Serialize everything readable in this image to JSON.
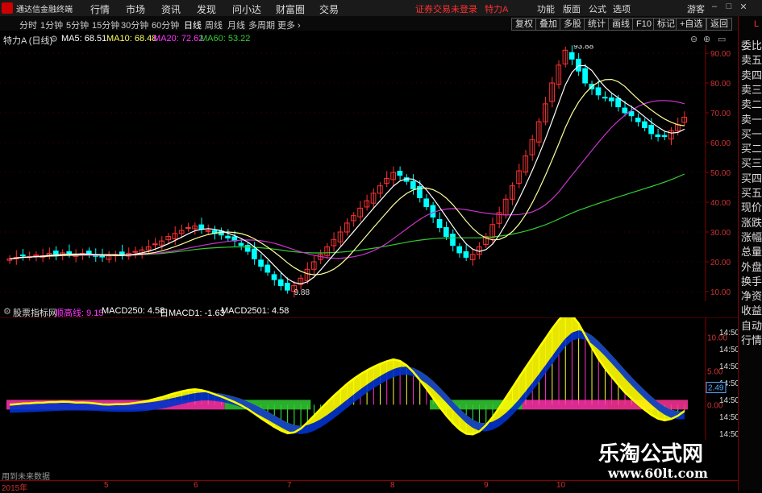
{
  "app": {
    "name": "通达信金融终端"
  },
  "menu": [
    "行情",
    "市场",
    "资讯",
    "发现",
    "问小达",
    "财富圈",
    "交易"
  ],
  "trade_status": "证券交易未登录",
  "stock_header": "特力A",
  "right_menu": [
    "功能",
    "版面",
    "公式",
    "选项",
    "游客"
  ],
  "period_tabs": [
    "分时",
    "1分钟",
    "5分钟",
    "15分钟",
    "30分钟",
    "60分钟",
    "日线",
    "周线",
    "月线",
    "多周期",
    "更多"
  ],
  "active_tab": "日线",
  "tools": [
    "复权",
    "叠加",
    "多股",
    "统计",
    "画线",
    "F10",
    "标记",
    "+自选",
    "返回"
  ],
  "right_panel": [
    "委比",
    "卖五",
    "卖四",
    "卖三",
    "卖二",
    "卖一",
    "买一",
    "买二",
    "买三",
    "买四",
    "买五",
    "现价",
    "涨跌",
    "涨幅",
    "总量",
    "外盘",
    "换手",
    "净资",
    "收益",
    "自动",
    "行情"
  ],
  "right_panel_letter": "L",
  "main": {
    "title": "特力A (日线)",
    "ma": [
      {
        "label": "MA5: 68.51",
        "color": "#ffffff"
      },
      {
        "label": "MA10: 68.48",
        "color": "#ffff66"
      },
      {
        "label": "MA20: 72.62",
        "color": "#ff33ff"
      },
      {
        "label": "MA60: 53.22",
        "color": "#33cc33"
      }
    ],
    "y_ticks": [
      "90.00",
      "80.00",
      "70.00",
      "60.00",
      "50.00",
      "40.00",
      "30.00",
      "20.00",
      "10.00"
    ],
    "y_min": 10,
    "y_max": 90,
    "annotations": {
      "high": "93.88",
      "low": "9.88"
    }
  },
  "indicator": {
    "name": "股票指标网",
    "legend": [
      {
        "label": "顺高线: 9.15",
        "color": "#ff33ff"
      },
      {
        "label": "MACD250: 4.58",
        "color": "#ffffff"
      },
      {
        "label": "日MACD1: -1.63",
        "color": "#ffffff"
      },
      {
        "label": "MACD2501: 4.58",
        "color": "#ffffff"
      }
    ],
    "y_ticks": [
      "10.00",
      "5.00",
      "0.00"
    ],
    "y_min": -10,
    "y_max": 12,
    "value_box": "2.49",
    "right_times": [
      "14:50",
      "14:50",
      "14:50",
      "14:50",
      "14:50",
      "14:50",
      "14:50"
    ]
  },
  "footer_text": "用到未来数据",
  "dates": [
    "2015年",
    "5",
    "6",
    "7",
    "8",
    "9",
    "10"
  ],
  "watermark": {
    "cn": "乐淘公式网",
    "url": "www.60lt.com"
  },
  "chart_data": {
    "type": "candlestick",
    "title": "特力A (日线)",
    "ylim": [
      10,
      95
    ],
    "close": [
      21,
      21.5,
      22,
      21.8,
      22.3,
      22,
      22.8,
      22.5,
      23,
      22.6,
      22.2,
      22.8,
      22.5,
      22,
      21.6,
      22,
      22.5,
      22.3,
      22.8,
      23.5,
      24,
      25,
      26,
      27,
      28.5,
      29.5,
      30.5,
      31.5,
      32,
      31,
      30.5,
      29.5,
      29,
      28,
      27,
      25.5,
      23.5,
      21,
      18.5,
      16.5,
      14,
      12,
      10.5,
      12,
      14.5,
      17.5,
      20,
      22.5,
      25,
      27.5,
      30,
      33,
      35.5,
      38,
      40.5,
      43,
      45.5,
      48,
      50,
      49,
      47,
      44.5,
      41.5,
      38.5,
      35,
      31.5,
      28.5,
      25.5,
      23,
      21.5,
      22.5,
      25,
      28.5,
      32.5,
      36.5,
      41,
      45.5,
      50.5,
      55.5,
      61,
      67,
      73,
      80,
      86,
      91,
      88,
      84,
      80,
      78,
      76,
      75,
      74,
      72,
      70,
      69,
      67,
      65,
      63,
      62,
      62,
      64,
      66,
      68.5
    ]
  }
}
